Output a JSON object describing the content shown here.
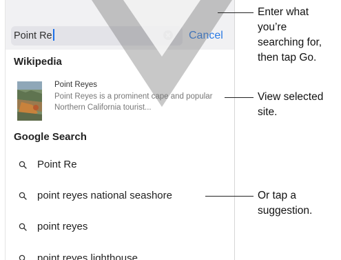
{
  "search": {
    "query": "Point Re",
    "cancel_label": "Cancel"
  },
  "sections": {
    "wikipedia_header": "Wikipedia",
    "google_header": "Google Search"
  },
  "wikipedia_result": {
    "title": "Point Reyes",
    "description": "Point Reyes is a prominent cape and popular Northern California tourist...",
    "thumbnail_icon": "landscape-photo"
  },
  "suggestions": [
    {
      "label": "Point Re",
      "icon": "search-icon"
    },
    {
      "label": "point reyes national seashore",
      "icon": "search-icon"
    },
    {
      "label": "point reyes",
      "icon": "search-icon"
    },
    {
      "label": "point reyes lighthouse",
      "icon": "search-icon"
    }
  ],
  "callouts": [
    {
      "text": "Enter what\nyou’re\nsearching for,\nthen tap Go."
    },
    {
      "text": "View selected\nsite."
    },
    {
      "text": "Or tap a\nsuggestion."
    }
  ],
  "colors": {
    "accent": "#2a7ae4",
    "search_bar_bg": "#f1f1f3",
    "field_bg": "#e3e3e8"
  }
}
